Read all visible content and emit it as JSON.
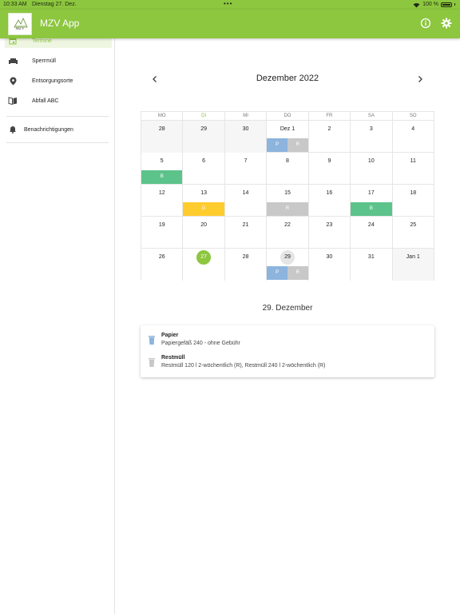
{
  "status_bar": {
    "time": "10:33 AM",
    "date": "Dienstag 27. Dez.",
    "dots": "•••",
    "battery": "100 %"
  },
  "app_bar": {
    "title": "MZV App",
    "logo_text": "MZV",
    "info_icon": "info-icon",
    "settings_icon": "gear-icon"
  },
  "colors": {
    "brand": "#8dc63f",
    "papier": "#8cb4dd",
    "restmuell": "#c8c8c8",
    "bio": "#5cc38a",
    "gelb": "#ffcc2e"
  },
  "sidebar": {
    "items": [
      {
        "label": "Termine",
        "icon": "calendar-icon",
        "active": true
      },
      {
        "label": "Sperrmüll",
        "icon": "sofa-icon",
        "active": false
      },
      {
        "label": "Entsorgungsorte",
        "icon": "location-pin-icon",
        "active": false
      },
      {
        "label": "Abfall ABC",
        "icon": "book-icon",
        "active": false
      }
    ],
    "notifications": {
      "label": "Benachrichtigungen",
      "icon": "bell-icon"
    }
  },
  "calendar": {
    "month_title": "Dezember 2022",
    "weekdays": [
      "MO",
      "DI",
      "MI",
      "DO",
      "FR",
      "SA",
      "SO"
    ],
    "rows": [
      [
        {
          "day": "28",
          "other": true
        },
        {
          "day": "29",
          "other": true
        },
        {
          "day": "30",
          "other": true
        },
        {
          "day": "Dez 1",
          "events": [
            {
              "label": "P",
              "type": "papier"
            },
            {
              "label": "R",
              "type": "rest"
            }
          ]
        },
        {
          "day": "2"
        },
        {
          "day": "3"
        },
        {
          "day": "4"
        }
      ],
      [
        {
          "day": "5",
          "events": [
            {
              "label": "B",
              "type": "bio"
            }
          ]
        },
        {
          "day": "6"
        },
        {
          "day": "7"
        },
        {
          "day": "8"
        },
        {
          "day": "9"
        },
        {
          "day": "10"
        },
        {
          "day": "11"
        }
      ],
      [
        {
          "day": "12"
        },
        {
          "day": "13",
          "events": [
            {
              "label": "G",
              "type": "gelb"
            }
          ]
        },
        {
          "day": "14"
        },
        {
          "day": "15",
          "events": [
            {
              "label": "R",
              "type": "rest"
            }
          ]
        },
        {
          "day": "16"
        },
        {
          "day": "17",
          "events": [
            {
              "label": "B",
              "type": "bio"
            }
          ]
        },
        {
          "day": "18"
        }
      ],
      [
        {
          "day": "19"
        },
        {
          "day": "20"
        },
        {
          "day": "21"
        },
        {
          "day": "22"
        },
        {
          "day": "23"
        },
        {
          "day": "24"
        },
        {
          "day": "25"
        }
      ],
      [
        {
          "day": "26"
        },
        {
          "day": "27",
          "today": true
        },
        {
          "day": "28"
        },
        {
          "day": "29",
          "selected": true,
          "events": [
            {
              "label": "P",
              "type": "papier"
            },
            {
              "label": "R",
              "type": "rest"
            }
          ]
        },
        {
          "day": "30"
        },
        {
          "day": "31"
        },
        {
          "day": "Jan 1",
          "other": true
        }
      ]
    ]
  },
  "selected_day": {
    "title": "29. Dezember",
    "items": [
      {
        "title": "Papier",
        "subtitle": "Papiergefäß 240 - ohne Gebühr",
        "icon": "trash-bin-icon",
        "type": "papier"
      },
      {
        "title": "Restmüll",
        "subtitle": "Restmüll 120 l 2-wöchentlich (R), Restmüll 240 l 2-wöchentlich (R)",
        "icon": "trash-bin-icon",
        "type": "rest"
      }
    ]
  }
}
